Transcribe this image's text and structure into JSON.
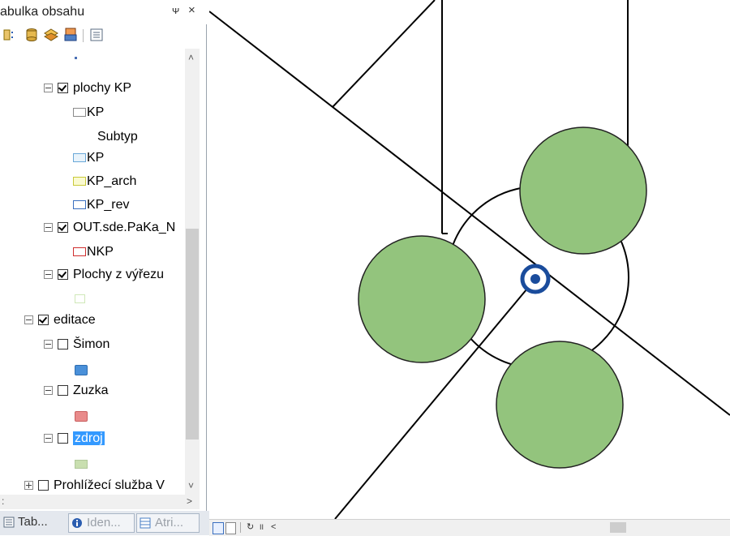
{
  "toc": {
    "title": "abulka obsahu",
    "pin": "ᴪ",
    "close": "×",
    "items": [
      {
        "text": "plochy KP",
        "checked": true
      },
      {
        "text": "KP"
      },
      {
        "text": "Subtyp"
      },
      {
        "text": "KP"
      },
      {
        "text": "KP_arch"
      },
      {
        "text": "KP_rev"
      },
      {
        "text": "OUT.sde.PaKa_N",
        "checked": true
      },
      {
        "text": "NKP"
      },
      {
        "text": "Plochy z výřezu",
        "checked": true
      },
      {
        "text": "editace",
        "checked": true
      },
      {
        "text": "Šimon",
        "checked": false
      },
      {
        "text": "Zuzka",
        "checked": false
      },
      {
        "text": "zdroj",
        "checked": false
      },
      {
        "text": "Prohlížecí služba V",
        "checked": false
      }
    ],
    "scroll_up": "˄",
    "scroll_down": "˅",
    "scroll_left": ":",
    "scroll_right": ">"
  },
  "tabs": [
    {
      "label": "Tab..."
    },
    {
      "label": "Iden..."
    },
    {
      "label": "Atri..."
    }
  ],
  "statusbar": {
    "refresh": "↻",
    "pause": "II",
    "prev": "<"
  },
  "icons": [
    "list-by-drawing-order-icon",
    "list-by-source-icon",
    "list-by-visibility-icon",
    "list-by-selection-icon",
    "options-icon"
  ],
  "colors": {
    "green_fill": "#93c47d",
    "selection": "#3399ff",
    "vertex_ring": "#1a4c9c",
    "symbol_blue": "#5b9bd5",
    "symbol_red": "#e98b8b",
    "symbol_green": "#c9dfb0"
  }
}
